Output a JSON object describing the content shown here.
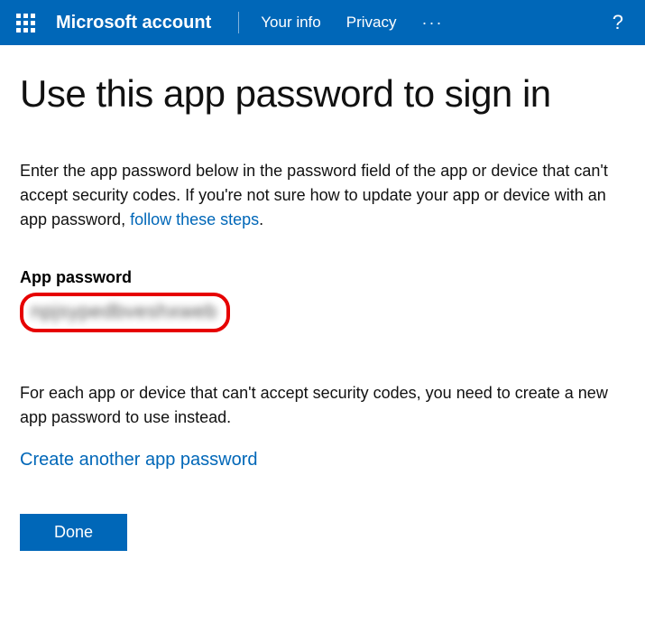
{
  "header": {
    "brand": "Microsoft account",
    "nav": {
      "your_info": "Your info",
      "privacy": "Privacy"
    },
    "more": "···",
    "help": "?"
  },
  "page": {
    "title": "Use this app password to sign in",
    "intro_text": "Enter the app password below in the password field of the app or device that can't accept security codes. If you're not sure how to update your app or device with an app password, ",
    "intro_link": "follow these steps",
    "intro_period": ".",
    "field_label": "App password",
    "password_value": "npjsypedbveshxweb",
    "secondary_text": "For each app or device that can't accept security codes, you need to create a new app password to use instead.",
    "create_link": "Create another app password",
    "done_label": "Done"
  }
}
